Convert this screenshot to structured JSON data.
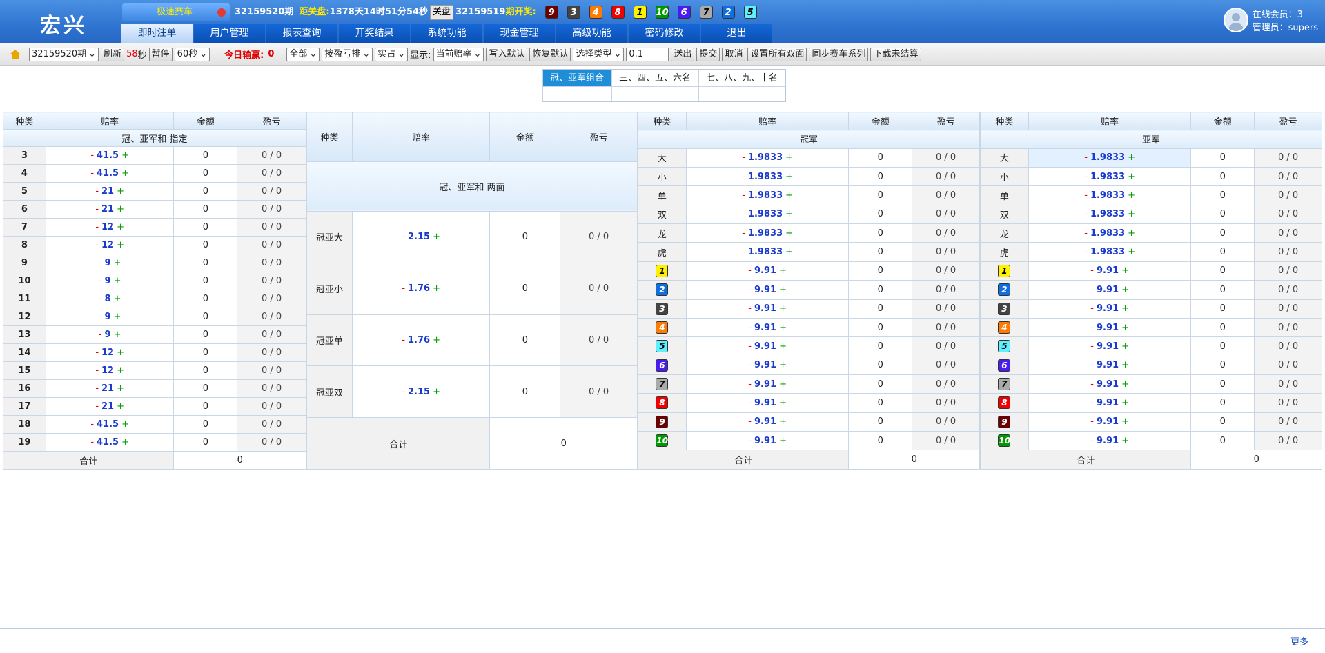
{
  "header": {
    "logo": "宏兴",
    "game": "极速赛车",
    "period": "32159520期",
    "close_label": "距关盘:",
    "close_time": "1378天14时51分54秒",
    "close_button": "关盘",
    "prev_period_label": "32159519期开奖:",
    "draw_balls": [
      "9",
      "3",
      "4",
      "8",
      "1",
      "10",
      "6",
      "7",
      "2",
      "5"
    ],
    "online_label": "在线会员：3",
    "admin_label": "管理员：supers"
  },
  "nav": [
    "即时注单",
    "用户管理",
    "报表查询",
    "开奖结果",
    "系统功能",
    "现金管理",
    "高级功能",
    "密码修改",
    "退出"
  ],
  "toolbar": {
    "period_select": "32159520期",
    "refresh": "刷新",
    "countdown": "58",
    "sec": "秒",
    "pause": "暂停",
    "interval": "60秒",
    "today_label": "今日输赢:",
    "today_value": "0",
    "filter_all": "全部",
    "sort": "按盈亏排",
    "real": "实占",
    "show_label": "显示:",
    "odds_mode": "当前赔率",
    "write_default": "写入默认",
    "restore_default": "恢复默认",
    "type_select": "选择类型",
    "step_value": "0.1",
    "send": "送出",
    "submit": "提交",
    "cancel": "取消",
    "set_all": "设置所有双面",
    "sync": "同步赛车系列",
    "download": "下载未结算"
  },
  "rank_tabs": [
    "冠、亚军组合",
    "三、四、五、六名",
    "七、八、九、十名"
  ],
  "table_headers": {
    "kind": "种类",
    "odds": "赔率",
    "amount": "金额",
    "pl": "盈亏",
    "total": "合计",
    "total_value": "0"
  },
  "t1": {
    "title": "冠、亚军和 指定",
    "rows": [
      {
        "k": "3",
        "o": "41.5"
      },
      {
        "k": "4",
        "o": "41.5"
      },
      {
        "k": "5",
        "o": "21"
      },
      {
        "k": "6",
        "o": "21"
      },
      {
        "k": "7",
        "o": "12"
      },
      {
        "k": "8",
        "o": "12"
      },
      {
        "k": "9",
        "o": "9"
      },
      {
        "k": "10",
        "o": "9"
      },
      {
        "k": "11",
        "o": "8"
      },
      {
        "k": "12",
        "o": "9"
      },
      {
        "k": "13",
        "o": "9"
      },
      {
        "k": "14",
        "o": "12"
      },
      {
        "k": "15",
        "o": "12"
      },
      {
        "k": "16",
        "o": "21"
      },
      {
        "k": "17",
        "o": "21"
      },
      {
        "k": "18",
        "o": "41.5"
      },
      {
        "k": "19",
        "o": "41.5"
      }
    ]
  },
  "t2": {
    "title": "冠、亚军和 两面",
    "rows": [
      {
        "k": "冠亚大",
        "o": "2.15"
      },
      {
        "k": "冠亚小",
        "o": "1.76"
      },
      {
        "k": "冠亚单",
        "o": "1.76"
      },
      {
        "k": "冠亚双",
        "o": "2.15"
      }
    ]
  },
  "t3": {
    "title": "冠军",
    "rows": [
      {
        "k": "大",
        "o": "1.9833"
      },
      {
        "k": "小",
        "o": "1.9833"
      },
      {
        "k": "单",
        "o": "1.9833"
      },
      {
        "k": "双",
        "o": "1.9833"
      },
      {
        "k": "龙",
        "o": "1.9833"
      },
      {
        "k": "虎",
        "o": "1.9833"
      },
      {
        "k": "1",
        "o": "9.91",
        "ball": true
      },
      {
        "k": "2",
        "o": "9.91",
        "ball": true
      },
      {
        "k": "3",
        "o": "9.91",
        "ball": true
      },
      {
        "k": "4",
        "o": "9.91",
        "ball": true
      },
      {
        "k": "5",
        "o": "9.91",
        "ball": true
      },
      {
        "k": "6",
        "o": "9.91",
        "ball": true
      },
      {
        "k": "7",
        "o": "9.91",
        "ball": true
      },
      {
        "k": "8",
        "o": "9.91",
        "ball": true
      },
      {
        "k": "9",
        "o": "9.91",
        "ball": true
      },
      {
        "k": "10",
        "o": "9.91",
        "ball": true
      }
    ]
  },
  "t4": {
    "title": "亚军",
    "rows": [
      {
        "k": "大",
        "o": "1.9833"
      },
      {
        "k": "小",
        "o": "1.9833"
      },
      {
        "k": "单",
        "o": "1.9833"
      },
      {
        "k": "双",
        "o": "1.9833"
      },
      {
        "k": "龙",
        "o": "1.9833"
      },
      {
        "k": "虎",
        "o": "1.9833"
      },
      {
        "k": "1",
        "o": "9.91",
        "ball": true
      },
      {
        "k": "2",
        "o": "9.91",
        "ball": true
      },
      {
        "k": "3",
        "o": "9.91",
        "ball": true
      },
      {
        "k": "4",
        "o": "9.91",
        "ball": true
      },
      {
        "k": "5",
        "o": "9.91",
        "ball": true
      },
      {
        "k": "6",
        "o": "9.91",
        "ball": true
      },
      {
        "k": "7",
        "o": "9.91",
        "ball": true
      },
      {
        "k": "8",
        "o": "9.91",
        "ball": true
      },
      {
        "k": "9",
        "o": "9.91",
        "ball": true
      },
      {
        "k": "10",
        "o": "9.91",
        "ball": true
      }
    ]
  },
  "cell_amount": "0",
  "cell_pl": "0 / 0",
  "odds_minus": "-",
  "odds_plus": "+",
  "footer": {
    "more": "更多"
  }
}
